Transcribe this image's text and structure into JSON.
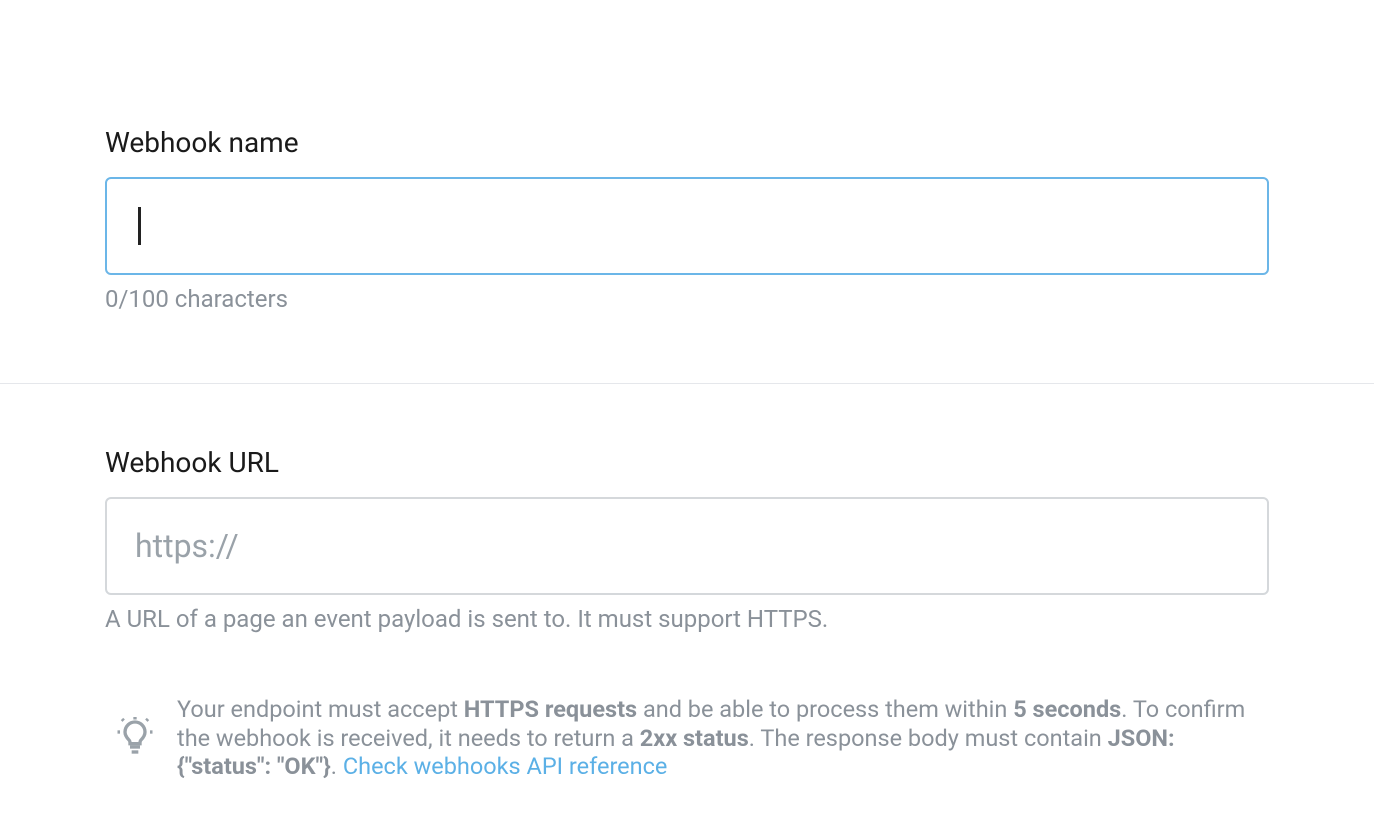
{
  "webhookName": {
    "label": "Webhook name",
    "value": "",
    "counter": "0/100 characters"
  },
  "webhookUrl": {
    "label": "Webhook URL",
    "placeholder": "https://",
    "value": "",
    "hint": "A URL of a page an event payload is sent to. It must support HTTPS."
  },
  "tip": {
    "pre1": "Your endpoint must accept ",
    "bold1": "HTTPS requests",
    "mid1": " and be able to process them within ",
    "bold2": "5 seconds",
    "mid2": ". To confirm the webhook is received, it needs to return a ",
    "bold3": "2xx status",
    "mid3": ". The response body must contain ",
    "bold4": "JSON: {\"status\": \"OK\"}",
    "post": ". ",
    "link": "Check webhooks API reference"
  }
}
